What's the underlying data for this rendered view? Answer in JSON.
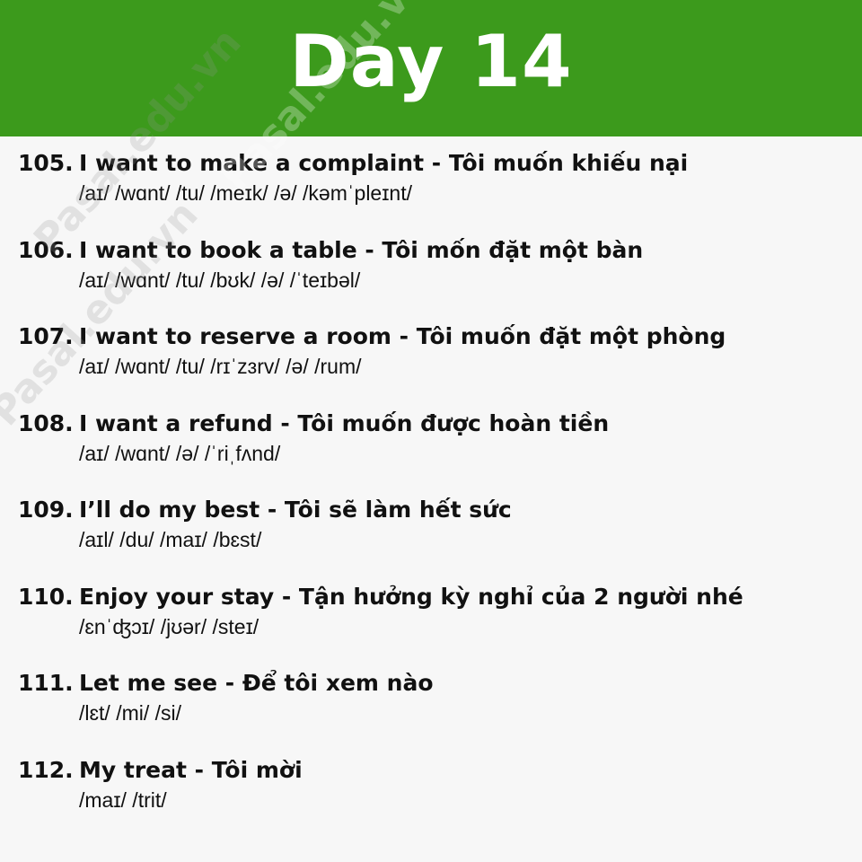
{
  "header": {
    "title": "Day 14",
    "background": "#3c9a1c"
  },
  "watermark": {
    "text": "Pasal.edu.vn"
  },
  "phrases": [
    {
      "number": "105.",
      "text": "I want to make a complaint - Tôi muốn khiếu nại",
      "ipa": "/aɪ/ /wɑnt/ /tu/ /meɪk/ /ə/ /kəmˈpleɪnt/"
    },
    {
      "number": "106.",
      "text": "I want to book a table - Tôi mốn đặt một bàn",
      "ipa": "/aɪ/ /wɑnt/ /tu/ /bʊk/ /ə/ /ˈteɪbəl/"
    },
    {
      "number": "107.",
      "text": "I want to reserve a room - Tôi muốn đặt một phòng",
      "ipa": "/aɪ/ /wɑnt/ /tu/ /rɪˈzɜrv/ /ə/ /rum/"
    },
    {
      "number": "108.",
      "text": "I want a refund  - Tôi muốn được hoàn tiền",
      "ipa": "/aɪ/ /wɑnt/ /ə/ /ˈriˌfʌnd/"
    },
    {
      "number": "109.",
      "text": "I’ll do my best - Tôi sẽ làm hết sức",
      "ipa": "/aɪl/ /du/ /maɪ/ /bɛst/"
    },
    {
      "number": "110.",
      "text": "Enjoy your stay - Tận hưởng kỳ nghỉ của 2 người nhé",
      "ipa": "/ɛnˈʤɔɪ/ /jʊər/ /steɪ/"
    },
    {
      "number": "111.",
      "text": "Let me see - Để tôi xem nào",
      "ipa": "/lɛt/ /mi/ /si/"
    },
    {
      "number": "112.",
      "text": "My treat - Tôi mời",
      "ipa": "/maɪ/ /trit/"
    }
  ]
}
